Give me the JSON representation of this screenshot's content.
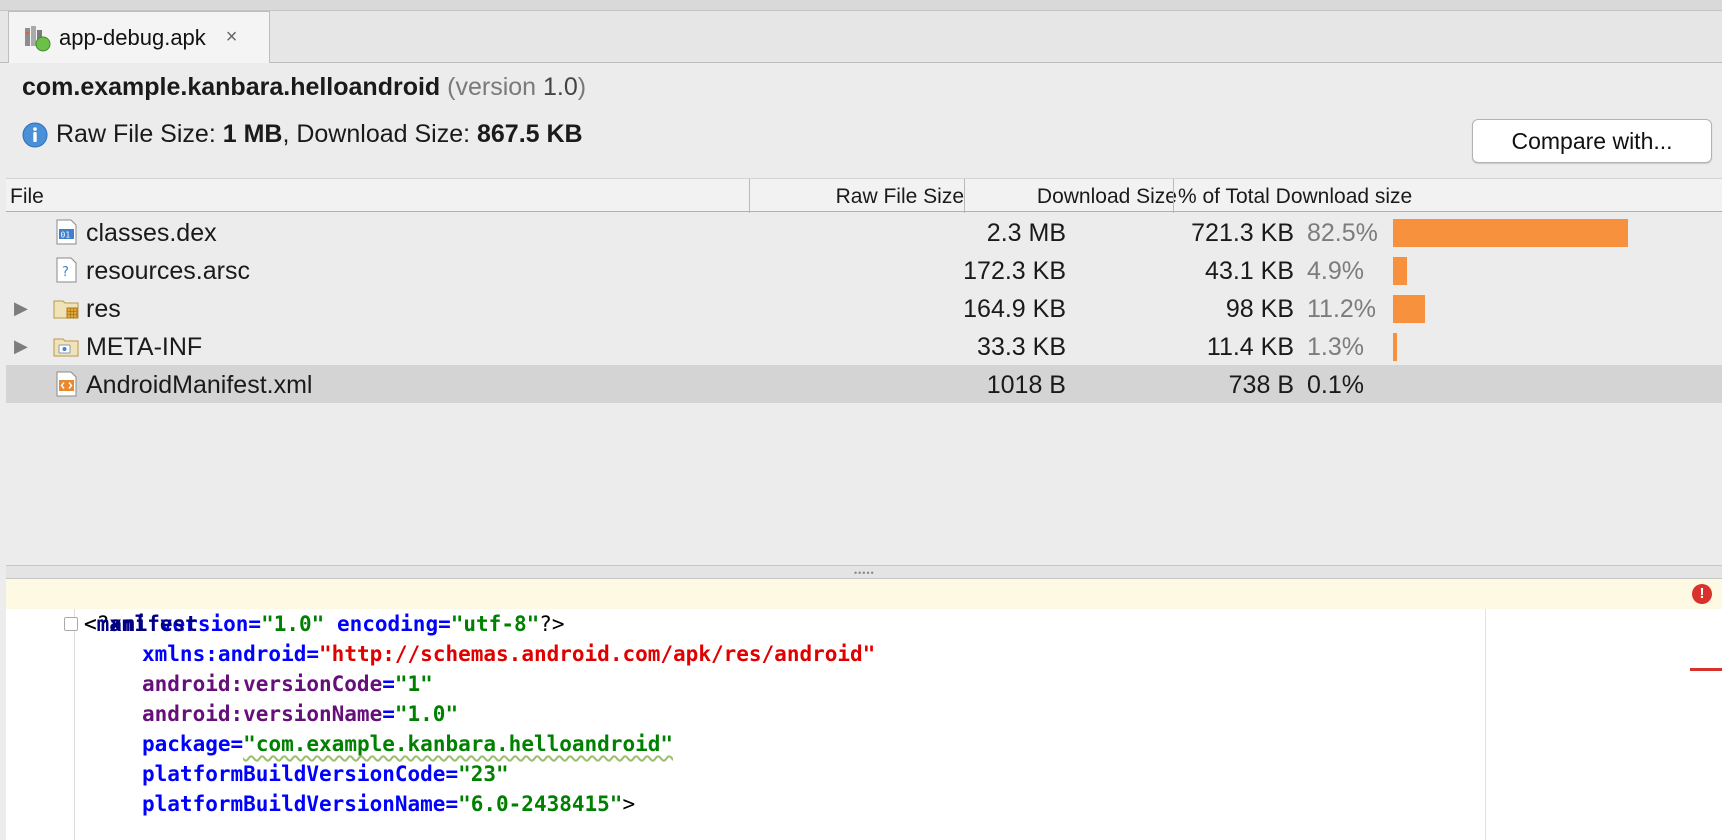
{
  "tab": {
    "label": "app-debug.apk",
    "close": "×",
    "icon": "apk-file-icon"
  },
  "header": {
    "package_name": "com.example.kanbara.helloandroid",
    "version_open": "(version ",
    "version_number": "1.0",
    "version_close": ")",
    "raw_label": "Raw File Size: ",
    "raw_value": "1 MB",
    "separator": ", Download Size: ",
    "download_value": "867.5 KB",
    "compare_button": "Compare with..."
  },
  "table": {
    "columns": [
      "File",
      "Raw File Size",
      "Download Size",
      "% of Total Download size"
    ],
    "rows": [
      {
        "name": "classes.dex",
        "icon": "dex-file-icon",
        "raw": "2.3 MB",
        "download": "721.3 KB",
        "percent": "82.5%",
        "fraction": 0.825,
        "expandable": false
      },
      {
        "name": "resources.arsc",
        "icon": "unknown-file-icon",
        "raw": "172.3 KB",
        "download": "43.1 KB",
        "percent": "4.9%",
        "fraction": 0.049,
        "expandable": false
      },
      {
        "name": "res",
        "icon": "resource-folder-icon",
        "raw": "164.9 KB",
        "download": "98 KB",
        "percent": "11.2%",
        "fraction": 0.112,
        "expandable": true
      },
      {
        "name": "META-INF",
        "icon": "folder-icon",
        "raw": "33.3 KB",
        "download": "11.4 KB",
        "percent": "1.3%",
        "fraction": 0.013,
        "expandable": true
      },
      {
        "name": "AndroidManifest.xml",
        "icon": "xml-file-icon",
        "raw": "1018 B",
        "download": "738 B",
        "percent": "0.1%",
        "fraction": 0.001,
        "expandable": false,
        "selected": true
      }
    ],
    "bar_color": "#f7913d"
  },
  "editor": {
    "lines": [
      [
        "<?",
        "xml",
        " ",
        "version",
        "=",
        "\"1.0\"",
        " ",
        "encoding",
        "=",
        "\"utf-8\"",
        "?>"
      ],
      [
        "<",
        "manifest"
      ],
      [
        "xmlns:android",
        "=",
        "\"http://schemas.android.com/apk/res/android\""
      ],
      [
        "android:versionCode",
        "=",
        "\"1\""
      ],
      [
        "android:versionName",
        "=",
        "\"1.0\""
      ],
      [
        "package",
        "=",
        "\"com.example.kanbara.helloandroid\""
      ],
      [
        "platformBuildVersionCode",
        "=",
        "\"23\""
      ],
      [
        "platformBuildVersionName",
        "=",
        "\"6.0-2438415\"",
        ">"
      ]
    ],
    "error_icon": "!"
  }
}
